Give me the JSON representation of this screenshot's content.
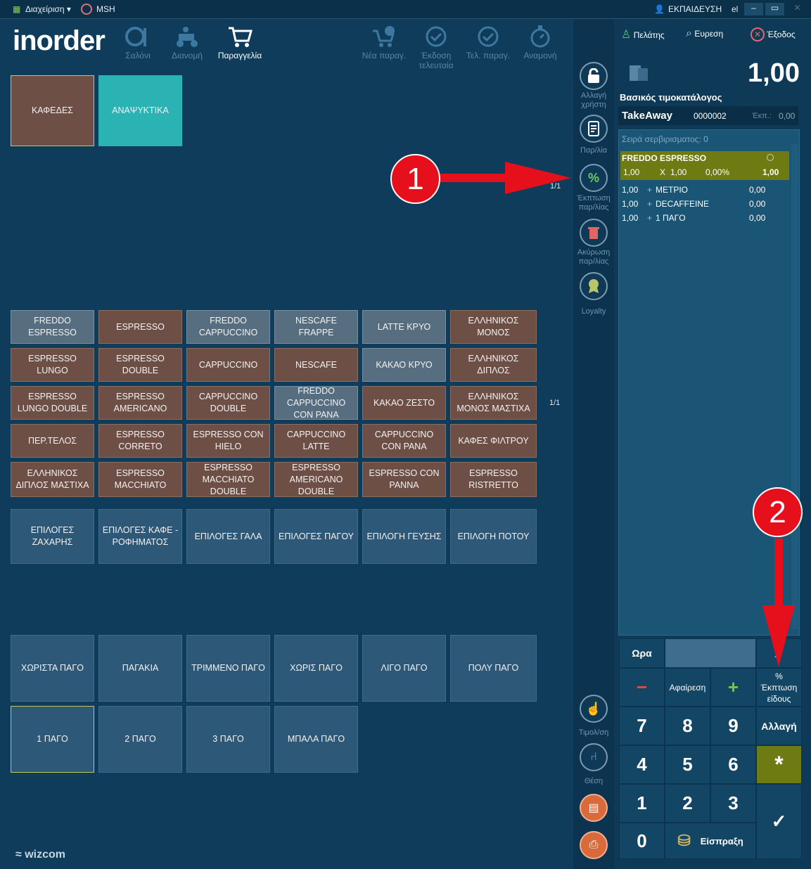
{
  "topbar": {
    "menu_label": "Διαχείριση",
    "msh": "MSH",
    "user": "ΕΚΠΑΙΔΕΥΣΗ",
    "lang": "el"
  },
  "logo": "inorder",
  "nav": [
    {
      "label": "Σαλόνι"
    },
    {
      "label": "Διανομή"
    },
    {
      "label": "Παραγγελία"
    },
    {
      "label": "Νέα παραγ."
    },
    {
      "label": "Έκδοση τελευταία"
    },
    {
      "label": "Τελ. παραγ."
    },
    {
      "label": "Αναμονή"
    }
  ],
  "categories": [
    "ΚΑΦΕΔΕΣ",
    "ΑΝΑΨΥΚΤΙΚΑ"
  ],
  "cat_page": "1/1",
  "products": [
    "FREDDO ESPRESSO",
    "ESPRESSO",
    "FREDDO CAPPUCCINO",
    "NESCAFE FRAPPE",
    "LATTE ΚΡΥΟ",
    "ΕΛΛΗΝΙΚΟΣ ΜΟΝΟΣ",
    "ESPRESSO LUNGO",
    "ESPRESSO DOUBLE",
    "CAPPUCCINO",
    "NESCAFE",
    "ΚΑΚΑΟ ΚΡΥΟ",
    "ΕΛΛΗΝΙΚΟΣ ΔΙΠΛΟΣ",
    "ESPRESSO LUNGO DOUBLE",
    "ESPRESSO AMERICANO",
    "CAPPUCCINO DOUBLE",
    "FREDDO CAPPUCCINO CON PANA",
    "ΚΑΚΑΟ ΖΕΣΤΟ",
    "ΕΛΛΗΝΙΚΟΣ ΜΟΝΟΣ ΜΑΣΤΙΧΑ",
    "ΠΕΡ.ΤΕΛΟΣ",
    "ESPRESSO CORRETO",
    "ESPRESSO CON HIELO",
    "CAPPUCCINO LATTE",
    "CAPPUCCINO CON PANA",
    "ΚΑΦΕΣ ΦΙΛΤΡΟΥ",
    "ΕΛΛΗΝΙΚΟΣ ΔΙΠΛΟΣ ΜΑΣΤΙΧΑ",
    "ESPRESSO MACCHIATO",
    "ESPRESSO MACCHIATO DOUBLE",
    "ESPRESSO AMERICANO DOUBLE",
    "ESPRESSO CON PANNA",
    "ESPRESSO RISTRETTO"
  ],
  "prod_page": "1/1",
  "options": [
    "ΕΠΙΛΟΓΕΣ ΖΑΧΑΡΗΣ",
    "ΕΠΙΛΟΓΕΣ ΚΑΦΕ - ΡΟΦΗΜΑΤΟΣ",
    "ΕΠΙΛΟΓΕΣ ΓΑΛΑ",
    "ΕΠΙΛΟΓΕΣ ΠΑΓΟΥ",
    "ΕΠΙΛΟΓΗ ΓΕΥΣΗΣ",
    "ΕΠΙΛΟΓΗ ΠΟΤΟΥ"
  ],
  "modifiers": [
    "ΧΩΡΙΣΤΑ ΠΑΓΟ",
    "ΠΑΓΑΚΙΑ",
    "ΤΡΙΜΜΕΝΟ ΠΑΓΟ",
    "ΧΩΡΙΣ ΠΑΓΟ",
    "ΛΙΓΟ ΠΑΓΟ",
    "ΠΟΛΥ ΠΑΓΟ",
    "1 ΠΑΓΟ",
    "2 ΠΑΓΟ",
    "3 ΠΑΓΟ",
    "ΜΠΑΛΑ ΠΑΓΟ"
  ],
  "sidebar": {
    "change_user": "Αλλαγή χρήστη",
    "order": "Παρ/λία",
    "discount": "Έκπτωση παρ/λίας",
    "cancel": "Ακύρωση παρ/λίας",
    "loyalty": "Loyalty",
    "invoice": "Τιμολ/ση",
    "seat": "Θέση"
  },
  "right": {
    "customer": "Πελάτης",
    "search": "Ευρεση",
    "exit": "Έξοδος",
    "total": "1,00",
    "pricelist": "Βασικός τιμοκατάλογος",
    "order_type": "TakeAway",
    "order_no": "0000002",
    "disc_label": "Έκπ.:",
    "disc_value": "0,00",
    "serving": "Σειρά σερβιρισματος: 0"
  },
  "order_item": {
    "name": "FREDDO ESPRESSO",
    "qty": "1,00",
    "x": "X",
    "price": "1,00",
    "disc": "0,00%",
    "total": "1,00"
  },
  "order_mods": [
    {
      "qty": "1,00",
      "name": "ΜΕΤΡΙΟ",
      "price": "0,00"
    },
    {
      "qty": "1,00",
      "name": "DECAFFEINE",
      "price": "0,00"
    },
    {
      "qty": "1,00",
      "name": "1 ΠΑΓΟ",
      "price": "0,00"
    }
  ],
  "keypad": {
    "hour": "Ωρα",
    "minus": "−",
    "remove": "Αφαίρεση",
    "plus": "+",
    "item_disc": "% Έκπτωση είδους",
    "change": "Αλλαγή",
    "star": "*",
    "pay": "Είσπραξη",
    "check": "✓",
    "digits": [
      "7",
      "8",
      "9",
      "4",
      "5",
      "6",
      "1",
      "2",
      "3",
      "0"
    ]
  },
  "annotations": {
    "a1": "1",
    "a2": "2"
  },
  "footer": "wizcom",
  "colors": {
    "brown": "#6e4f45",
    "grey": "#566e7f",
    "blue": "#2e5878",
    "teal": "#2bb3b3",
    "olive": "#6e7a12",
    "accent_red": "#e5101c"
  }
}
